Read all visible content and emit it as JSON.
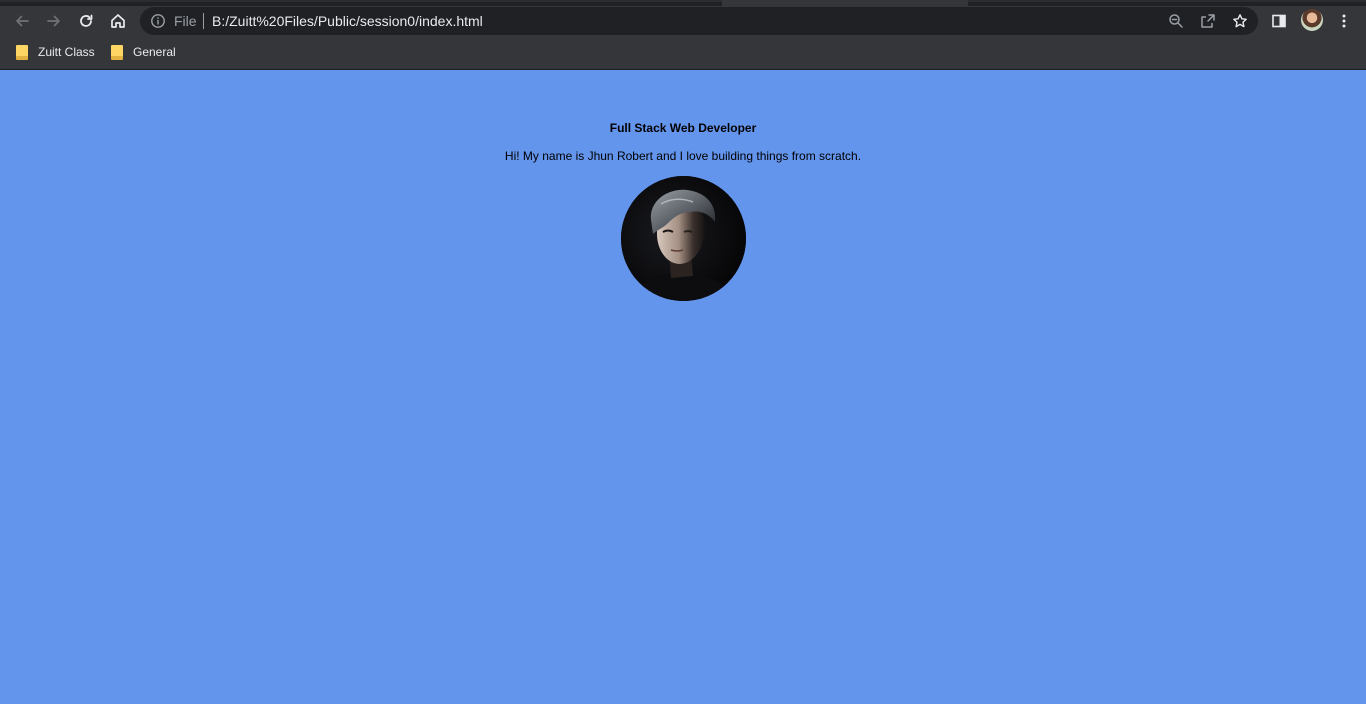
{
  "toolbar": {
    "back_icon": "arrow-left-icon",
    "forward_icon": "arrow-right-icon",
    "reload_icon": "reload-icon",
    "home_icon": "home-icon"
  },
  "omnibox": {
    "scheme_label": "File",
    "url": "B:/Zuitt%20Files/Public/session0/index.html",
    "info_icon": "info-icon",
    "zoom_icon": "zoom-icon",
    "share_icon": "share-icon",
    "bookmark_icon": "star-icon"
  },
  "toolbar_right": {
    "side_panel_icon": "side-panel-icon",
    "profile_icon": "profile-avatar",
    "menu_icon": "kebab-menu-icon"
  },
  "bookmarks_bar": {
    "items": [
      {
        "label": "Zuitt Class",
        "icon": "folder-icon"
      },
      {
        "label": "General",
        "icon": "folder-icon"
      }
    ]
  },
  "page": {
    "background": "#6495ed",
    "title": "Full Stack Web Developer",
    "intro": "Hi! My name is Jhun Robert and I love building things from scratch."
  },
  "colors": {
    "chrome_dark": "#202124",
    "chrome_toolbar": "#35363a",
    "folder": "#fdd663"
  }
}
